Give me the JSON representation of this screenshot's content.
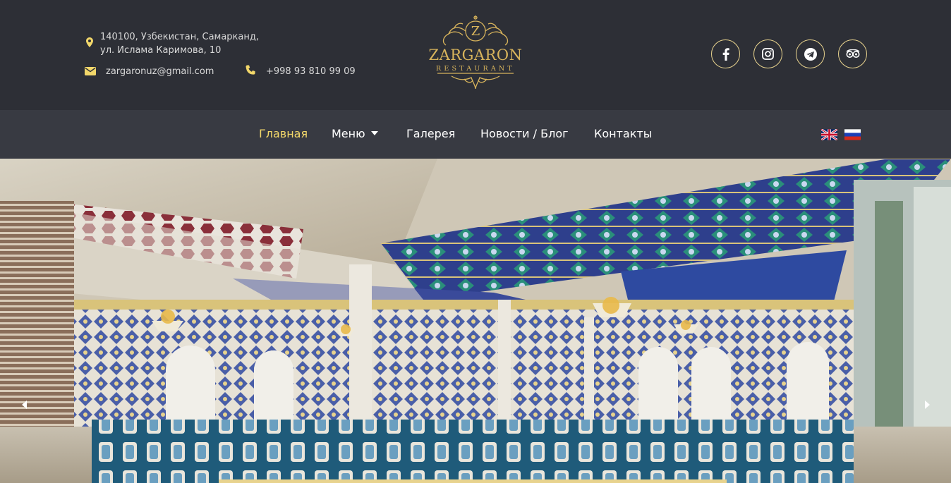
{
  "header": {
    "address_line1": "140100, Узбекистан, Самарканд,",
    "address_line2": "ул. Ислама Каримова, 10",
    "email": "zargaronuz@gmail.com",
    "phone": "+998 93 810 99 09",
    "logo_text": "ZARGARON",
    "logo_subtext": "RESTAURANT",
    "logo_monogram": "Z",
    "accent_color": "#d8b45c"
  },
  "socials": [
    {
      "icon": "facebook-icon"
    },
    {
      "icon": "instagram-icon"
    },
    {
      "icon": "telegram-icon"
    },
    {
      "icon": "tripadvisor-icon"
    }
  ],
  "nav": {
    "items": [
      {
        "label": "Главная",
        "active": true
      },
      {
        "label": "Меню",
        "dropdown": true
      },
      {
        "label": "Галерея"
      },
      {
        "label": "Новости / Блог"
      },
      {
        "label": "Контакты"
      }
    ],
    "active_color": "#f2d76a",
    "languages": [
      "english-flag-icon",
      "russian-flag-icon"
    ]
  },
  "hero": {
    "image": "restaurant-hall-photo",
    "prev_icon": "chevron-left-icon",
    "next_icon": "chevron-right-icon"
  }
}
